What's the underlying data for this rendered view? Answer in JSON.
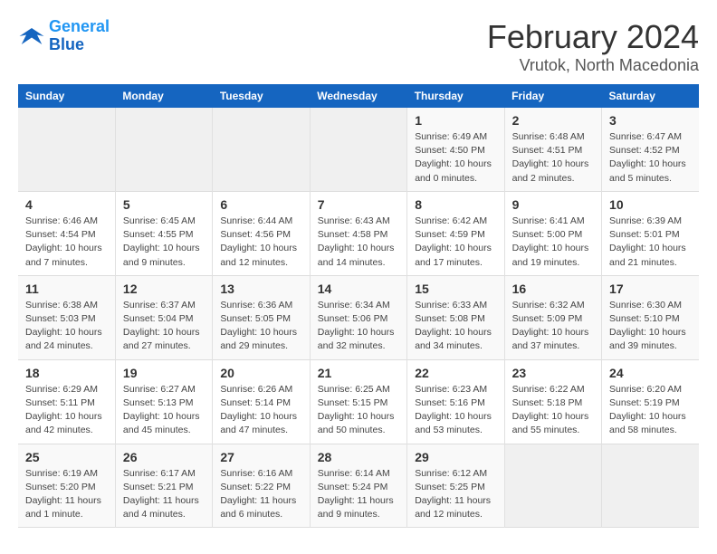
{
  "logo": {
    "line1": "General",
    "line2": "Blue"
  },
  "title": "February 2024",
  "subtitle": "Vrutok, North Macedonia",
  "days_of_week": [
    "Sunday",
    "Monday",
    "Tuesday",
    "Wednesday",
    "Thursday",
    "Friday",
    "Saturday"
  ],
  "weeks": [
    [
      {
        "day": "",
        "info": ""
      },
      {
        "day": "",
        "info": ""
      },
      {
        "day": "",
        "info": ""
      },
      {
        "day": "",
        "info": ""
      },
      {
        "day": "1",
        "info": "Sunrise: 6:49 AM\nSunset: 4:50 PM\nDaylight: 10 hours\nand 0 minutes."
      },
      {
        "day": "2",
        "info": "Sunrise: 6:48 AM\nSunset: 4:51 PM\nDaylight: 10 hours\nand 2 minutes."
      },
      {
        "day": "3",
        "info": "Sunrise: 6:47 AM\nSunset: 4:52 PM\nDaylight: 10 hours\nand 5 minutes."
      }
    ],
    [
      {
        "day": "4",
        "info": "Sunrise: 6:46 AM\nSunset: 4:54 PM\nDaylight: 10 hours\nand 7 minutes."
      },
      {
        "day": "5",
        "info": "Sunrise: 6:45 AM\nSunset: 4:55 PM\nDaylight: 10 hours\nand 9 minutes."
      },
      {
        "day": "6",
        "info": "Sunrise: 6:44 AM\nSunset: 4:56 PM\nDaylight: 10 hours\nand 12 minutes."
      },
      {
        "day": "7",
        "info": "Sunrise: 6:43 AM\nSunset: 4:58 PM\nDaylight: 10 hours\nand 14 minutes."
      },
      {
        "day": "8",
        "info": "Sunrise: 6:42 AM\nSunset: 4:59 PM\nDaylight: 10 hours\nand 17 minutes."
      },
      {
        "day": "9",
        "info": "Sunrise: 6:41 AM\nSunset: 5:00 PM\nDaylight: 10 hours\nand 19 minutes."
      },
      {
        "day": "10",
        "info": "Sunrise: 6:39 AM\nSunset: 5:01 PM\nDaylight: 10 hours\nand 21 minutes."
      }
    ],
    [
      {
        "day": "11",
        "info": "Sunrise: 6:38 AM\nSunset: 5:03 PM\nDaylight: 10 hours\nand 24 minutes."
      },
      {
        "day": "12",
        "info": "Sunrise: 6:37 AM\nSunset: 5:04 PM\nDaylight: 10 hours\nand 27 minutes."
      },
      {
        "day": "13",
        "info": "Sunrise: 6:36 AM\nSunset: 5:05 PM\nDaylight: 10 hours\nand 29 minutes."
      },
      {
        "day": "14",
        "info": "Sunrise: 6:34 AM\nSunset: 5:06 PM\nDaylight: 10 hours\nand 32 minutes."
      },
      {
        "day": "15",
        "info": "Sunrise: 6:33 AM\nSunset: 5:08 PM\nDaylight: 10 hours\nand 34 minutes."
      },
      {
        "day": "16",
        "info": "Sunrise: 6:32 AM\nSunset: 5:09 PM\nDaylight: 10 hours\nand 37 minutes."
      },
      {
        "day": "17",
        "info": "Sunrise: 6:30 AM\nSunset: 5:10 PM\nDaylight: 10 hours\nand 39 minutes."
      }
    ],
    [
      {
        "day": "18",
        "info": "Sunrise: 6:29 AM\nSunset: 5:11 PM\nDaylight: 10 hours\nand 42 minutes."
      },
      {
        "day": "19",
        "info": "Sunrise: 6:27 AM\nSunset: 5:13 PM\nDaylight: 10 hours\nand 45 minutes."
      },
      {
        "day": "20",
        "info": "Sunrise: 6:26 AM\nSunset: 5:14 PM\nDaylight: 10 hours\nand 47 minutes."
      },
      {
        "day": "21",
        "info": "Sunrise: 6:25 AM\nSunset: 5:15 PM\nDaylight: 10 hours\nand 50 minutes."
      },
      {
        "day": "22",
        "info": "Sunrise: 6:23 AM\nSunset: 5:16 PM\nDaylight: 10 hours\nand 53 minutes."
      },
      {
        "day": "23",
        "info": "Sunrise: 6:22 AM\nSunset: 5:18 PM\nDaylight: 10 hours\nand 55 minutes."
      },
      {
        "day": "24",
        "info": "Sunrise: 6:20 AM\nSunset: 5:19 PM\nDaylight: 10 hours\nand 58 minutes."
      }
    ],
    [
      {
        "day": "25",
        "info": "Sunrise: 6:19 AM\nSunset: 5:20 PM\nDaylight: 11 hours\nand 1 minute."
      },
      {
        "day": "26",
        "info": "Sunrise: 6:17 AM\nSunset: 5:21 PM\nDaylight: 11 hours\nand 4 minutes."
      },
      {
        "day": "27",
        "info": "Sunrise: 6:16 AM\nSunset: 5:22 PM\nDaylight: 11 hours\nand 6 minutes."
      },
      {
        "day": "28",
        "info": "Sunrise: 6:14 AM\nSunset: 5:24 PM\nDaylight: 11 hours\nand 9 minutes."
      },
      {
        "day": "29",
        "info": "Sunrise: 6:12 AM\nSunset: 5:25 PM\nDaylight: 11 hours\nand 12 minutes."
      },
      {
        "day": "",
        "info": ""
      },
      {
        "day": "",
        "info": ""
      }
    ]
  ]
}
